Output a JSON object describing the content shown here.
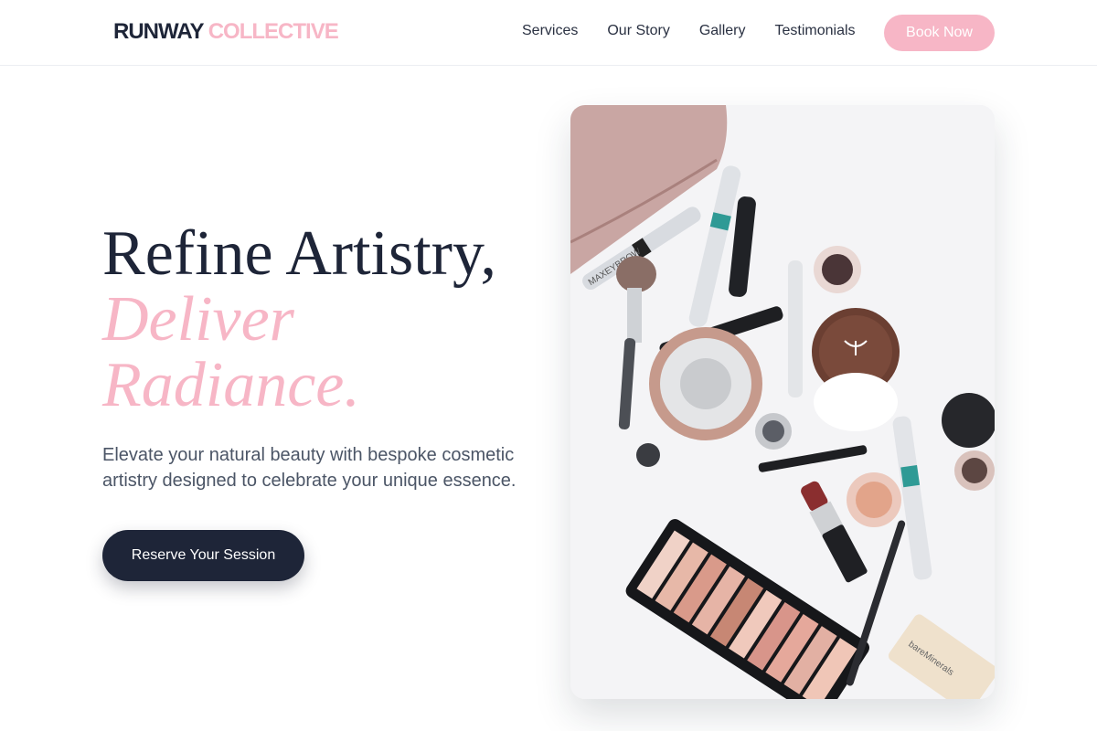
{
  "brand": {
    "part1": "RUNWAY",
    "part2": "COLLECTIVE"
  },
  "nav": {
    "items": [
      {
        "label": "Services"
      },
      {
        "label": "Our Story"
      },
      {
        "label": "Gallery"
      },
      {
        "label": "Testimonials"
      }
    ],
    "cta_label": "Book Now"
  },
  "hero": {
    "title_line1": "Refine Artistry,",
    "title_line2": "Deliver",
    "title_line3": "Radiance.",
    "subtitle": "Elevate your natural beauty with bespoke cosmetic artistry designed to celebrate your unique essence.",
    "cta_label": "Reserve Your Session",
    "image_text": {
      "brand_mark": "MAXEYBROW",
      "tube_label": "bareMinerals"
    }
  },
  "colors": {
    "navy": "#1e2538",
    "pink": "#f7b6c6",
    "text_muted": "#4b5566"
  }
}
